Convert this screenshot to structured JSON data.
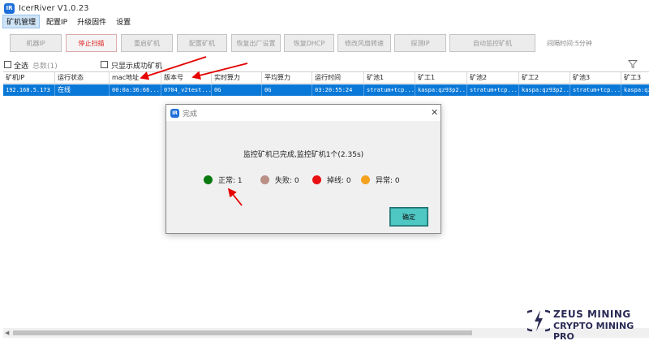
{
  "window": {
    "title": "IcerRiver V1.0.23",
    "app_icon": "IR"
  },
  "menu": [
    {
      "label": "矿机管理",
      "active": true
    },
    {
      "label": "配置IP",
      "active": false
    },
    {
      "label": "升级固件",
      "active": false
    },
    {
      "label": "设置",
      "active": false
    }
  ],
  "toolbar": {
    "buttons": [
      {
        "label": "机器IP"
      },
      {
        "label": "停止扫描"
      },
      {
        "label": "重启矿机"
      },
      {
        "label": "配置矿机"
      },
      {
        "label": "恢复出厂设置"
      },
      {
        "label": "恢复DHCP"
      },
      {
        "label": "修改风扇转速"
      },
      {
        "label": "探测IP"
      },
      {
        "label": "自动监控矿机"
      }
    ],
    "interval": "间隔时间:5分钟"
  },
  "filters": {
    "select_all": "全选",
    "total": "总数(1)",
    "only_success": "只显示成功矿机"
  },
  "grid": {
    "columns": [
      "矿机IP",
      "运行状态",
      "mac地址",
      "版本号",
      "实时算力",
      "平均算力",
      "运行时间",
      "矿池1",
      "矿工1",
      "矿池2",
      "矿工2",
      "矿池3",
      "矿工3"
    ],
    "rows": [
      [
        "192.168.5.173",
        "在线",
        "00:0a:36:66...",
        "0704_v2test...",
        "0G",
        "0G",
        "03:20:55:24",
        "stratum+tcp...",
        "kaspa:qz93p2...",
        "stratum+tcp...",
        "kaspa:qz93p2...",
        "stratum+tcp...",
        "kaspa:qz..."
      ]
    ]
  },
  "dialog": {
    "title": "完成",
    "message": "监控矿机已完成,监控矿机1个(2.35s)",
    "stats": [
      {
        "label": "正常: 1",
        "color": "#0a7a10"
      },
      {
        "label": "失败: 0",
        "color": "#b98f86"
      },
      {
        "label": "掉线: 0",
        "color": "#e81010"
      },
      {
        "label": "异常: 0",
        "color": "#f4a21e"
      }
    ],
    "ok_label": "确定"
  },
  "watermark": {
    "line1": "ZEUS MINING",
    "line2": "CRYPTO MINING PRO"
  },
  "colors": {
    "selected_row": "#0a78d7",
    "ok_button": "#4fc7c3",
    "annotation_arrow": "#e60000"
  }
}
